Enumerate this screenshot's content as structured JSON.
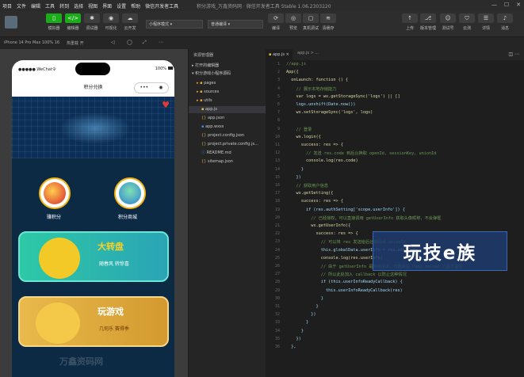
{
  "menubar": {
    "items": [
      "项目",
      "文件",
      "编辑",
      "工具",
      "转到",
      "选择",
      "视图",
      "界面",
      "设置",
      "帮助",
      "微信开发者工具"
    ],
    "window_title": "积分游戏_万鑫资码网 · 微信开发者工具 Stable 1.06.2303220"
  },
  "toolbar": {
    "left_buttons": [
      {
        "label": "模拟器",
        "icon": "phone-icon"
      },
      {
        "label": "编辑器",
        "icon": "code-icon"
      },
      {
        "label": "调试器",
        "icon": "bug-icon"
      },
      {
        "label": "可视化",
        "icon": "eye-icon"
      },
      {
        "label": "云开发",
        "icon": "cloud-icon"
      }
    ],
    "mode_select": "小程序模式",
    "compile_select": "普通编译",
    "center_buttons": [
      "编译",
      "预览",
      "真机调试",
      "清缓存"
    ],
    "right_buttons": [
      "上传",
      "版本管理",
      "测试号",
      "云测",
      "详情",
      "消息"
    ]
  },
  "subbar": {
    "device": "iPhone 14 Pro Max 100% 16",
    "hot_reload": "热重载 开"
  },
  "phone": {
    "status_left": "●●●●● WeChat令",
    "status_right": "100%",
    "nav_title": "积分兑换",
    "capsule_dots": "•••",
    "circle_items": [
      {
        "label": "赚积分",
        "icon": "gift-box-icon"
      },
      {
        "label": "积分商城",
        "icon": "shop-icon"
      }
    ],
    "cards": [
      {
        "title": "大转盘",
        "subtitle": "随春风  转惊喜",
        "icon": "wheel-icon"
      },
      {
        "title": "玩游戏",
        "subtitle": "几何乐  赛得季",
        "icon": "game-icon"
      }
    ],
    "watermark": "万鑫资码网"
  },
  "explorer": {
    "title": "资源管理器",
    "sections": [
      "打开的编辑器",
      "积分游戏小程序源码"
    ],
    "items": [
      {
        "name": "pages",
        "type": "folder"
      },
      {
        "name": "sources",
        "type": "folder"
      },
      {
        "name": "utils",
        "type": "folder"
      },
      {
        "name": "app.js",
        "type": "js",
        "selected": true
      },
      {
        "name": "app.json",
        "type": "json"
      },
      {
        "name": "app.wxss",
        "type": "wxss"
      },
      {
        "name": "project.config.json",
        "type": "json"
      },
      {
        "name": "project.private.config.js...",
        "type": "json"
      },
      {
        "name": "README.md",
        "type": "md"
      },
      {
        "name": "sitemap.json",
        "type": "json"
      }
    ]
  },
  "editor": {
    "tabs": [
      "app.js"
    ],
    "breadcrumb": "app.js > ...",
    "lines": [
      "//app.js",
      "App({",
      "  onLaunch: function () {",
      "    // 展示本地存储能力",
      "    var logs = wx.getStorageSync('logs') || []",
      "    logs.unshift(Date.now())",
      "    wx.setStorageSync('logs', logs)",
      "",
      "    // 登录",
      "    wx.login({",
      "      success: res => {",
      "        // 发送 res.code 到后台换取 openId, sessionKey, unionId",
      "        console.log(res.code)",
      "      }",
      "    })",
      "    // 获取用户信息",
      "    wx.getSetting({",
      "      success: res => {",
      "        if (res.authSetting['scope.userInfo']) {",
      "          // 已经授权，可以直接调用 getUserInfo 获取头像昵称，不会弹框",
      "          wx.getUserInfo({",
      "            success: res => {",
      "              // 可以将 res 发送给后台解码出 unionId",
      "              this.globalData.userInfo = res.userInfo",
      "              console.log(res.userInfo)",
      "              // 由于 getUserInfo 是网络请求，可能会在 Page.onLoad 之后才返回",
      "              // 所以此处加入 callback 以防止这种情况",
      "              if (this.userInfoReadyCallback) {",
      "                this.userInfoReadyCallback(res)",
      "              }",
      "            }",
      "          })",
      "        }",
      "      }",
      "    })",
      "  },"
    ]
  },
  "overlay": {
    "brand": "玩技e族"
  }
}
